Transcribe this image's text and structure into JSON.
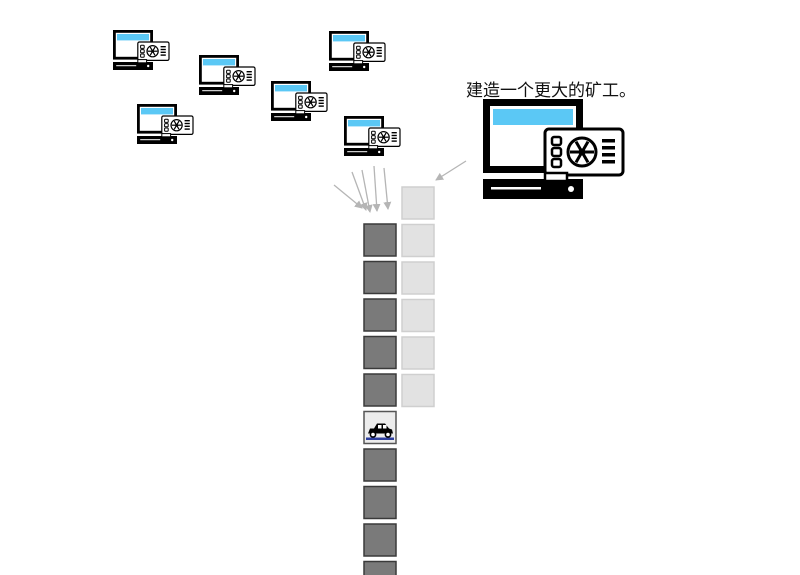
{
  "caption": "建造一个更大的矿工。",
  "colors": {
    "screen_blue": "#5bc8f5",
    "block_dark": "#7a7a7a",
    "block_light": "#e2e2e2",
    "block_light_border": "#cfcfcf",
    "arrow_gray": "#b5b5b5",
    "road_blue": "#2d3e9e",
    "ink": "#000000"
  },
  "miners_small": 6,
  "miner_large": 1,
  "chain_main_blocks": 10,
  "car_block_number": 6,
  "chain_side_blocks": 6
}
